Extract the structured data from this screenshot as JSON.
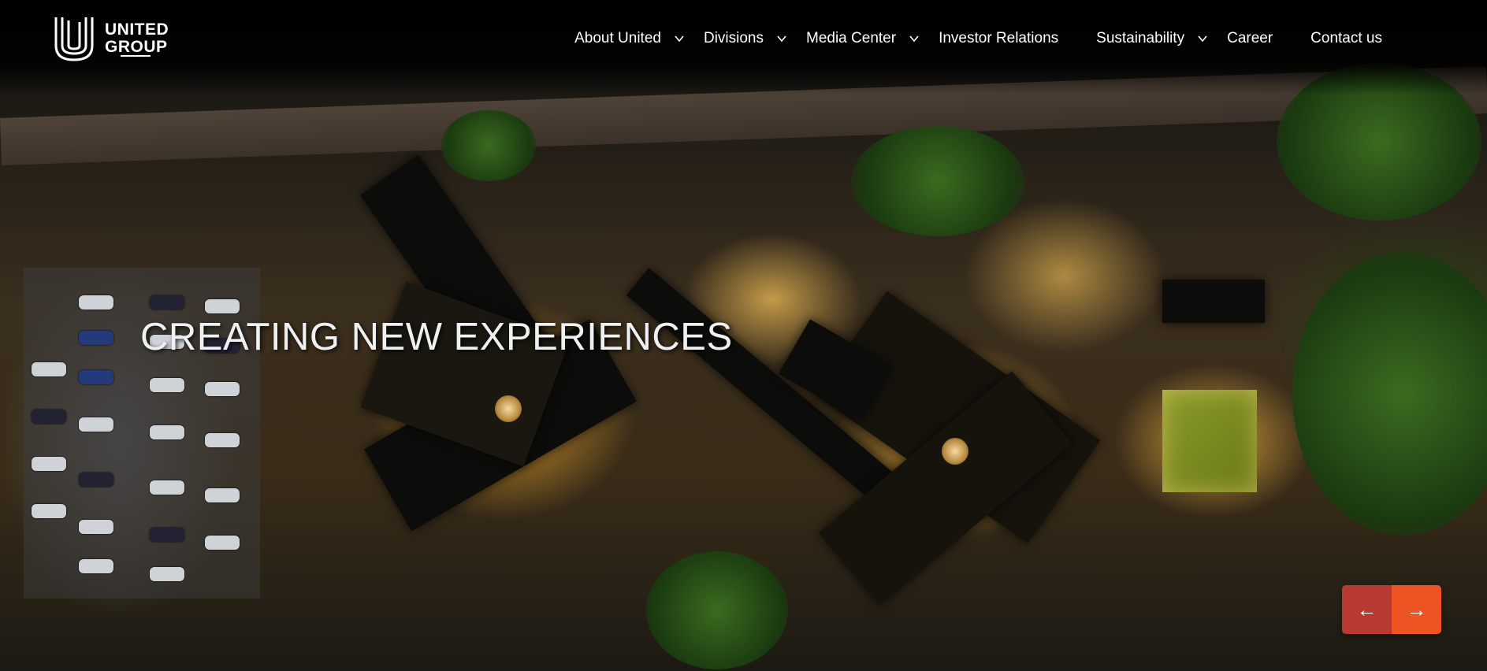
{
  "brand": {
    "line1": "UNITED",
    "line2": "GROUP",
    "logo_icon": "united-u-logo"
  },
  "nav": {
    "items": [
      {
        "label": "About United",
        "has_dropdown": true
      },
      {
        "label": "Divisions",
        "has_dropdown": true
      },
      {
        "label": "Media Center",
        "has_dropdown": true
      },
      {
        "label": "Investor Relations",
        "has_dropdown": false
      },
      {
        "label": "Sustainability",
        "has_dropdown": true
      },
      {
        "label": "Career",
        "has_dropdown": false
      },
      {
        "label": "Contact us",
        "has_dropdown": false
      }
    ]
  },
  "hero": {
    "headline": "CREATING NEW EXPERIENCES"
  },
  "slider": {
    "prev_icon": "←",
    "next_icon": "→",
    "prev_color": "#b63a32",
    "next_color": "#ee5324"
  }
}
